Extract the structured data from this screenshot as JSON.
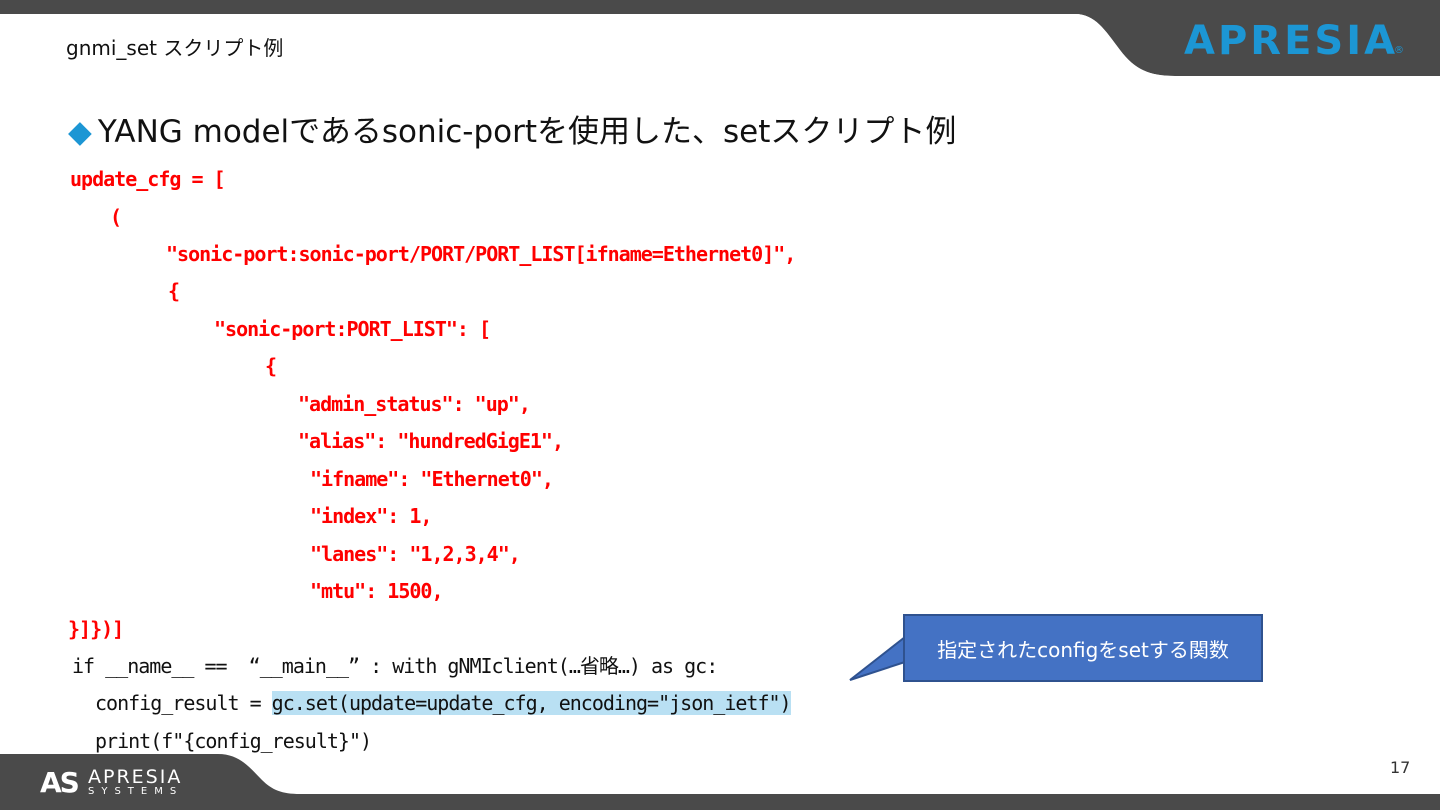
{
  "header": {
    "title": "gnmi_set  スクリプト例",
    "logo": "APRESIA",
    "logo_reg": "®"
  },
  "slide": {
    "bullet": "◆",
    "heading": "YANG modelであるsonic-portを使用した、setスクリプト例"
  },
  "code_lines": [
    "update_cfg = [",
    "(",
    "\"sonic-port:sonic-port/PORT/PORT_LIST[ifname=Ethernet0]\",",
    "{",
    "\"sonic-port:PORT_LIST\": [",
    "{",
    "\"admin_status\": \"up\",",
    "\"alias\": \"hundredGigE1\",",
    "\"ifname\": \"Ethernet0\",",
    "\"index\": 1,",
    "\"lanes\": \"1,2,3,4\",",
    "\"mtu\": 1500,",
    "}]})]",
    "if __name__ ==  “__main__” : with gNMIclient(…省略…) as gc:",
    "config_result = ",
    "gc.set(update=update_cfg, encoding=\"json_ietf\")",
    "print(f\"{config_result}\")"
  ],
  "callout": {
    "text": "指定されたconfigをsetする関数"
  },
  "footer": {
    "page_number": "17",
    "logo_mark": "AS",
    "logo_name": "APRESIA",
    "logo_sub": "SYSTEMS"
  },
  "colors": {
    "accent": "#1c96d4",
    "code_red": "#ff0000",
    "callout_bg": "#4472c4",
    "highlight": "#b9e0f3",
    "dark_bar": "#4a4a4a"
  }
}
